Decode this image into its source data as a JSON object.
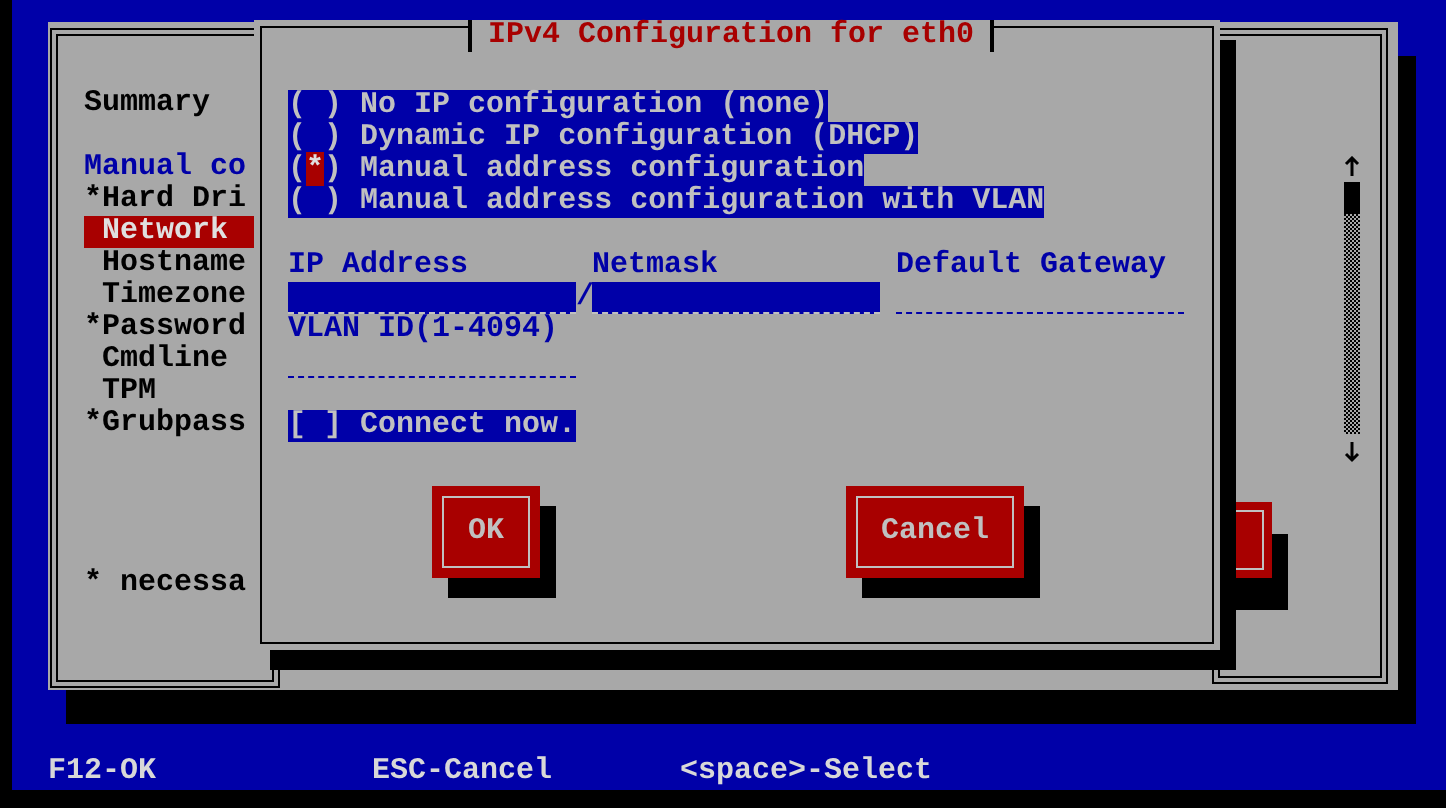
{
  "background_window": {
    "sidebar": [
      {
        "kind": "plain",
        "label": "Summary"
      },
      {
        "kind": "section",
        "label": "Manual co"
      },
      {
        "kind": "item",
        "label": "*Hard Dri",
        "required": true,
        "selected": false
      },
      {
        "kind": "item",
        "label": "Network",
        "required": false,
        "selected": true
      },
      {
        "kind": "item",
        "label": "Hostname",
        "required": false,
        "selected": false
      },
      {
        "kind": "item",
        "label": "Timezone",
        "required": false,
        "selected": false
      },
      {
        "kind": "item",
        "label": "*Password",
        "required": true,
        "selected": false
      },
      {
        "kind": "item",
        "label": "Cmdline",
        "required": false,
        "selected": false
      },
      {
        "kind": "item",
        "label": "TPM",
        "required": false,
        "selected": false
      },
      {
        "kind": "item",
        "label": "*Grubpass",
        "required": true,
        "selected": false
      }
    ],
    "footnote": "* necessa"
  },
  "dialog": {
    "title": "IPv4 Configuration for eth0",
    "options": [
      {
        "marker": "( )",
        "label": "No IP configuration (none)",
        "selected": false
      },
      {
        "marker": "( )",
        "label": "Dynamic IP configuration (DHCP)",
        "selected": false
      },
      {
        "marker": "(*)",
        "label": "Manual address configuration",
        "selected": true
      },
      {
        "marker": "( )",
        "label": "Manual address configuration with VLAN",
        "selected": false
      }
    ],
    "fields": [
      {
        "label": "IP Address",
        "highlighted": true
      },
      {
        "label": "Netmask",
        "highlighted": true
      },
      {
        "label": "Default Gateway",
        "highlighted": false
      }
    ],
    "separator": "/",
    "vlan_field": {
      "label": "VLAN ID(1-4094)",
      "highlighted": false
    },
    "connect_now": {
      "marker": "[ ]",
      "label": "Connect now.",
      "checked": false
    },
    "buttons": [
      "OK",
      "Cancel"
    ]
  },
  "status_bar": [
    "F12-OK",
    "ESC-Cancel",
    "<space>-Select"
  ]
}
